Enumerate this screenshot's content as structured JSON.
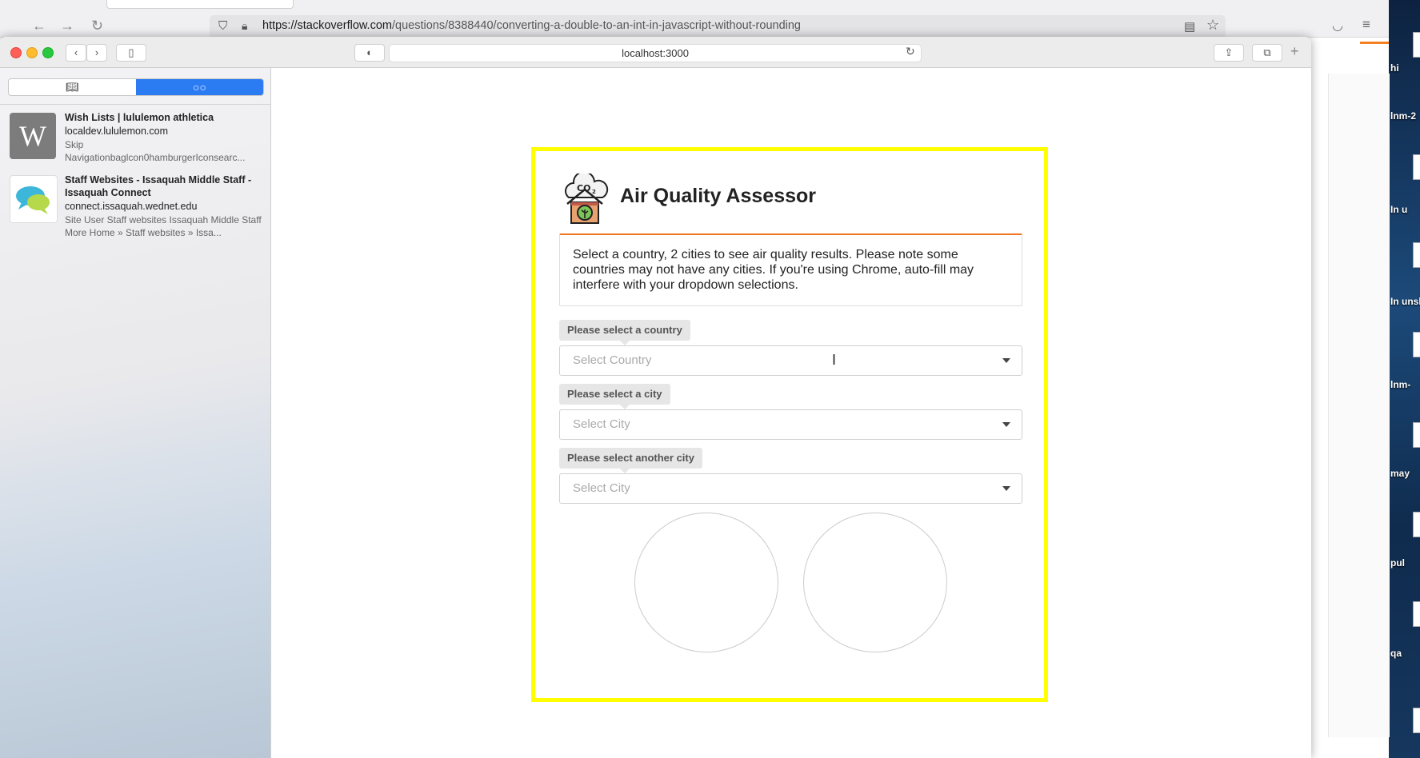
{
  "back_browser": {
    "url_host": "https://stackoverflow.com",
    "url_path": "/questions/8388440/converting-a-double-to-an-int-in-javascript-without-rounding"
  },
  "safari": {
    "address": "localhost:3000"
  },
  "reading_list": [
    {
      "thumb_letter": "W",
      "title": "Wish Lists | lululemon athletica",
      "host": "localdev.lululemon.com",
      "desc": "Skip Navigationbaglcon0hamburgerIconsearc..."
    },
    {
      "thumb_letter": "",
      "title": "Staff Websites - Issaquah Middle Staff - Issaquah Connect",
      "host": "connect.issaquah.wednet.edu",
      "desc": "Site User Staff websites Issaquah Middle Staff More Home » Staff websites » Issa..."
    }
  ],
  "app": {
    "title": "Air Quality Assessor",
    "info": "Select a country, 2 cities to see air quality results. Please note some countries may not have any cities. If you're using Chrome, auto-fill may interfere with your dropdown selections.",
    "country_label": "Please select a country",
    "country_placeholder": "Select Country",
    "city_label": "Please select a city",
    "city_placeholder": "Select City",
    "city2_label": "Please select another city",
    "city2_placeholder": "Select City"
  },
  "desktop_labels": [
    "hi",
    "lnm-2",
    "In u",
    "In unsh",
    "lnm-",
    "may",
    "pul",
    "qa"
  ],
  "colors": {
    "highlight_border": "#ffff00",
    "accent_orange": "#f27420",
    "segment_blue": "#2b7bf2"
  }
}
